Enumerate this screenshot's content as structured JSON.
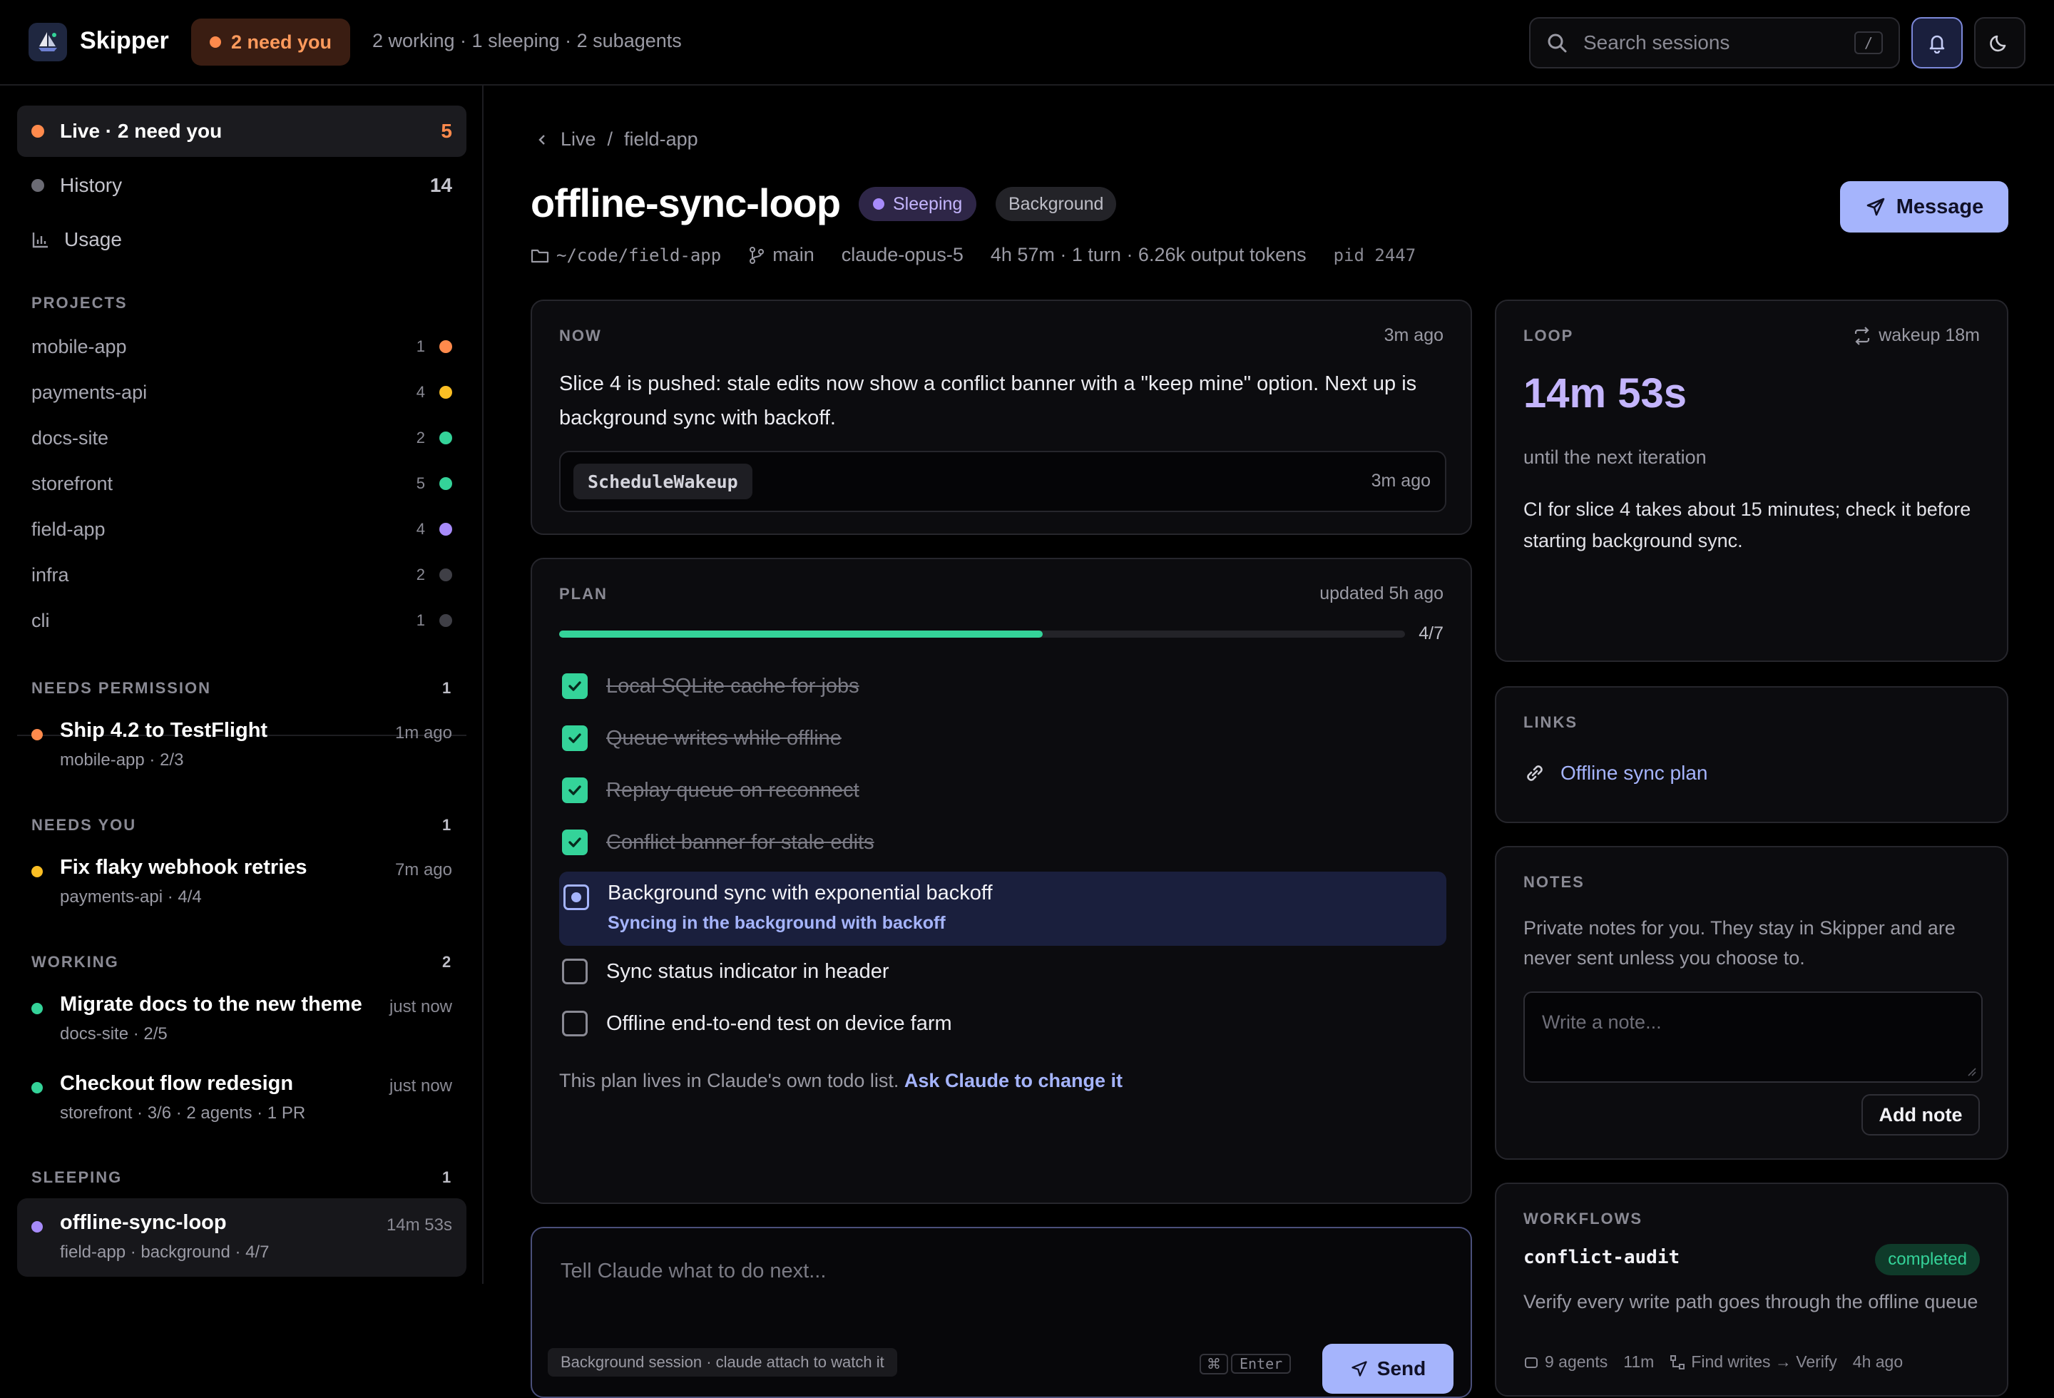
{
  "app": {
    "name": "Skipper",
    "need_badge": "2 need you",
    "summary": "2 working · 1 sleeping · 2 subagents"
  },
  "search": {
    "placeholder": "Search sessions",
    "shortcut": "/"
  },
  "colors": {
    "accent": "#a5b4fc",
    "need": "#ff8a4c",
    "amber": "#fbbf24",
    "green": "#34d399",
    "purple": "#a78bfa",
    "gray": "#4b4b52"
  },
  "sidebar": {
    "nav": [
      {
        "label": "Live · 2 need you",
        "count": "5"
      },
      {
        "label": "History",
        "count": "14"
      },
      {
        "label": "Usage"
      }
    ],
    "projects_heading": "PROJECTS",
    "projects": [
      {
        "name": "mobile-app",
        "count": "1",
        "color": "#ff8a4c"
      },
      {
        "name": "payments-api",
        "count": "4",
        "color": "#fbbf24"
      },
      {
        "name": "docs-site",
        "count": "2",
        "color": "#34d399"
      },
      {
        "name": "storefront",
        "count": "5",
        "color": "#34d399"
      },
      {
        "name": "field-app",
        "count": "4",
        "color": "#a78bfa"
      },
      {
        "name": "infra",
        "count": "2",
        "color": "#3f3f46"
      },
      {
        "name": "cli",
        "count": "1",
        "color": "#3f3f46"
      }
    ],
    "groups": [
      {
        "heading": "NEEDS PERMISSION",
        "count": "1"
      },
      {
        "heading": "NEEDS YOU",
        "count": "1"
      },
      {
        "heading": "WORKING",
        "count": "2"
      },
      {
        "heading": "SLEEPING",
        "count": "1"
      }
    ],
    "sessions": [
      {
        "title": "Ship 4.2 to TestFlight",
        "sub": "mobile-app  · 2/3",
        "time": "1m ago",
        "color": "#ff8a4c"
      },
      {
        "title": "Fix flaky webhook retries",
        "sub": "payments-api  · 4/4",
        "time": "7m ago",
        "color": "#fbbf24"
      },
      {
        "title": "Migrate docs to the new theme",
        "sub": "docs-site  · 2/5",
        "time": "just now",
        "color": "#34d399"
      },
      {
        "title": "Checkout flow redesign",
        "sub": "storefront  · 3/6  · 2 agents  · 1 PR",
        "time": "just now",
        "color": "#34d399"
      },
      {
        "title": "offline-sync-loop",
        "sub": "field-app  · background  · 4/7",
        "time": "14m 53s",
        "color": "#a78bfa"
      }
    ]
  },
  "breadcrumb": {
    "root": "Live",
    "sep": "/",
    "current": "field-app"
  },
  "session": {
    "title": "offline-sync-loop",
    "status": "Sleeping",
    "kind": "Background",
    "message_label": "Message",
    "path": "~/code/field-app",
    "branch": "main",
    "model": "claude-opus-5",
    "stats": "4h 57m · 1 turn · 6.26k output tokens",
    "pid": "pid 2447"
  },
  "now": {
    "label": "NOW",
    "time": "3m ago",
    "text": "Slice 4 is pushed: stale edits now show a conflict banner with a \"keep mine\" option. Next up is background sync with backoff.",
    "tool": "ScheduleWakeup",
    "tool_time": "3m ago"
  },
  "plan": {
    "label": "PLAN",
    "updated": "updated 5h ago",
    "progress": 0.5714,
    "progress_text": "4/7",
    "items": [
      {
        "text": "Local SQLite cache for jobs",
        "state": "done"
      },
      {
        "text": "Queue writes while offline",
        "state": "done"
      },
      {
        "text": "Replay queue on reconnect",
        "state": "done"
      },
      {
        "text": "Conflict banner for stale edits",
        "state": "done"
      },
      {
        "text": "Background sync with exponential backoff",
        "state": "current",
        "sub": "Syncing in the background with backoff"
      },
      {
        "text": "Sync status indicator in header",
        "state": "open"
      },
      {
        "text": "Offline end-to-end test on device farm",
        "state": "open"
      }
    ],
    "footer": "This plan lives in Claude's own todo list.",
    "footer_link": "Ask Claude to change it"
  },
  "composer": {
    "placeholder": "Tell Claude what to do next...",
    "hint": "Background session · claude attach to watch it",
    "kbd1": "⌘",
    "kbd2": "Enter",
    "send": "Send"
  },
  "loop": {
    "label": "LOOP",
    "wakeup": "wakeup 18m",
    "countdown": "14m 53s",
    "until": "until the next iteration",
    "note": "CI for slice 4 takes about 15 minutes; check it before starting background sync."
  },
  "links": {
    "label": "LINKS",
    "items": [
      "Offline sync plan"
    ]
  },
  "notes": {
    "label": "NOTES",
    "desc": "Private notes for you. They stay in Skipper and are never sent unless you choose to.",
    "placeholder": "Write a note...",
    "add": "Add note"
  },
  "workflows": {
    "label": "WORKFLOWS",
    "name": "conflict-audit",
    "status": "completed",
    "desc": "Verify every write path goes through the offline queue",
    "agents": "9 agents",
    "duration": "11m",
    "steps": "Find writes → Verify",
    "time": "4h ago"
  }
}
